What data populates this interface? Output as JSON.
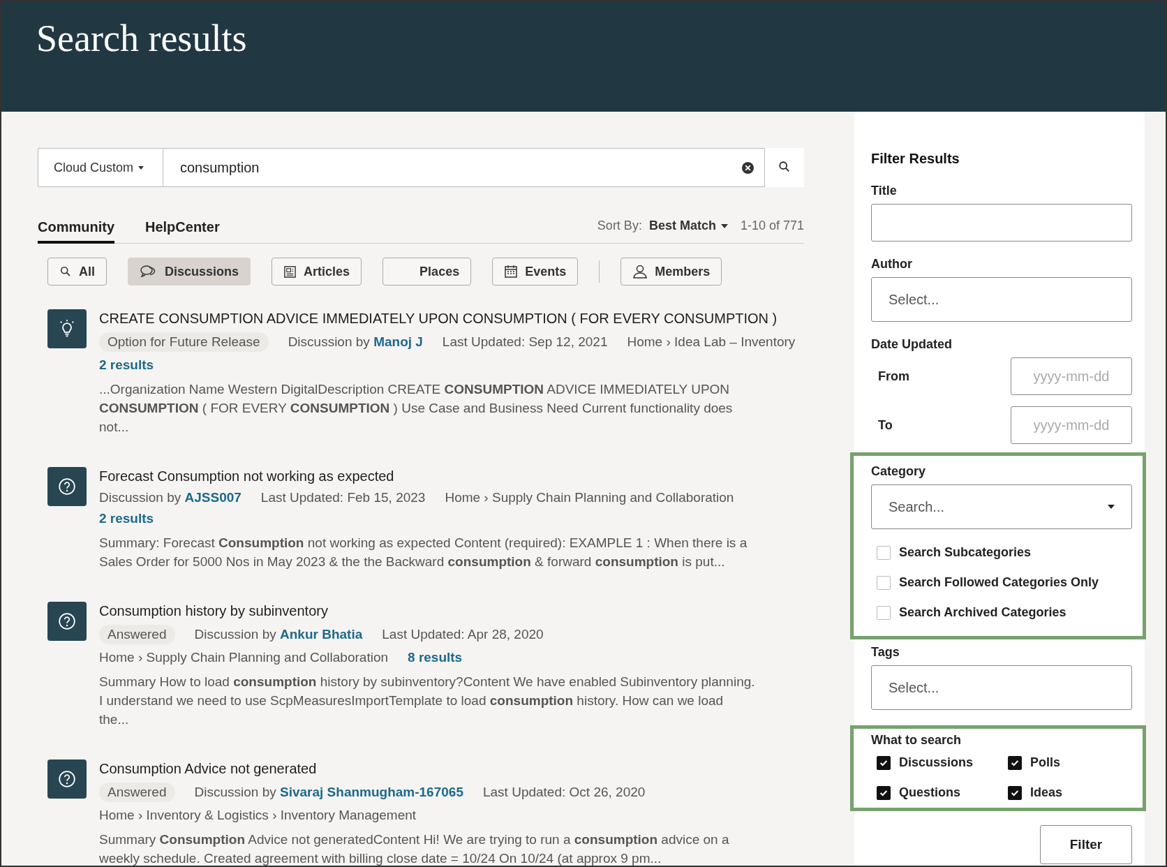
{
  "header": {
    "title": "Search results"
  },
  "search": {
    "scope": "Cloud Custom",
    "value": "consumption"
  },
  "tabs": [
    {
      "label": "Community",
      "selected": true
    },
    {
      "label": "HelpCenter",
      "selected": false
    }
  ],
  "sort": {
    "label": "Sort By:",
    "value": "Best Match",
    "range": "1-10 of 771"
  },
  "chips": [
    {
      "label": "All",
      "kind": "search",
      "selected": false
    },
    {
      "label": "Discussions",
      "kind": "chat",
      "selected": true
    },
    {
      "label": "Articles",
      "kind": "article",
      "selected": false
    },
    {
      "label": "Places",
      "kind": "plain",
      "selected": false
    },
    {
      "label": "Events",
      "kind": "calendar",
      "selected": false
    },
    {
      "label": "Members",
      "kind": "person",
      "selected": false
    }
  ],
  "results": [
    {
      "kind": "idea",
      "title": "CREATE CONSUMPTION ADVICE IMMEDIATELY UPON CONSUMPTION ( FOR EVERY CONSUMPTION )",
      "meta_lines": [
        [
          {
            "kind": "badge",
            "text": "Option for Future Release"
          },
          {
            "kind": "author",
            "prefix": "Discussion by",
            "name": "Manoj J"
          },
          {
            "kind": "text",
            "text": "Last Updated: Sep 12, 2021"
          },
          {
            "kind": "text",
            "text": "Home › Idea Lab – Inventory"
          }
        ],
        [
          {
            "kind": "count",
            "text": "2 results"
          }
        ]
      ],
      "snippet": "...Organization Name Western DigitalDescription CREATE **CONSUMPTION** ADVICE IMMEDIATELY UPON **CONSUMPTION** ( FOR EVERY **CONSUMPTION** ) Use Case and Business Need Current functionality does not..."
    },
    {
      "kind": "question",
      "title": "Forecast Consumption not working as expected",
      "meta_lines": [
        [
          {
            "kind": "author",
            "prefix": "Discussion by",
            "name": "AJSS007"
          },
          {
            "kind": "text",
            "text": "Last Updated: Feb 15, 2023"
          },
          {
            "kind": "text",
            "text": "Home › Supply Chain Planning and Collaboration"
          }
        ],
        [
          {
            "kind": "count",
            "text": "2 results"
          }
        ]
      ],
      "snippet": "Summary: Forecast **Consumption** not working as expected Content (required): EXAMPLE 1 : When there is a Sales Order for 5000 Nos in May 2023 & the the Backward **consumption** & forward **consumption** is put..."
    },
    {
      "kind": "question",
      "title": "Consumption history by subinventory",
      "meta_lines": [
        [
          {
            "kind": "badge",
            "text": "Answered"
          },
          {
            "kind": "author",
            "prefix": "Discussion by",
            "name": "Ankur Bhatia"
          },
          {
            "kind": "text",
            "text": "Last Updated: Apr 28, 2020"
          }
        ],
        [
          {
            "kind": "text",
            "text": "Home › Supply Chain Planning and Collaboration"
          },
          {
            "kind": "count",
            "text": "8 results"
          }
        ]
      ],
      "snippet": "Summary How to load **consumption** history by subinventory?Content We have enabled Subinventory planning. I understand we need to use ScpMeasuresImportTemplate to load **consumption** history. How can we load the..."
    },
    {
      "kind": "question",
      "title": "Consumption Advice not generated",
      "meta_lines": [
        [
          {
            "kind": "badge",
            "text": "Answered"
          },
          {
            "kind": "author",
            "prefix": "Discussion by",
            "name": "Sivaraj Shanmugham-167065"
          },
          {
            "kind": "text",
            "text": "Last Updated: Oct 26, 2020"
          }
        ],
        [
          {
            "kind": "text",
            "text": "Home › Inventory & Logistics › Inventory Management"
          }
        ]
      ],
      "snippet": "Summary **Consumption** Advice not generatedContent Hi! We are trying to run a **consumption** advice on a weekly schedule. Created agreement with billing close date = 10/24 On 10/24 (at approx 9 pm..."
    }
  ],
  "filter": {
    "heading": "Filter Results",
    "title_label": "Title",
    "author_label": "Author",
    "author_placeholder": "Select...",
    "date_label": "Date Updated",
    "from_label": "From",
    "from_placeholder": "yyyy-mm-dd",
    "to_label": "To",
    "to_placeholder": "yyyy-mm-dd",
    "category_label": "Category",
    "category_placeholder": "Search...",
    "category_options": [
      {
        "label": "Search Subcategories",
        "checked": false
      },
      {
        "label": "Search Followed Categories Only",
        "checked": false
      },
      {
        "label": "Search Archived Categories",
        "checked": false
      }
    ],
    "tags_label": "Tags",
    "tags_placeholder": "Select...",
    "what_label": "What to search",
    "what_options": [
      {
        "label": "Discussions",
        "checked": true
      },
      {
        "label": "Polls",
        "checked": true
      },
      {
        "label": "Questions",
        "checked": true
      },
      {
        "label": "Ideas",
        "checked": true
      }
    ],
    "button": "Filter"
  }
}
